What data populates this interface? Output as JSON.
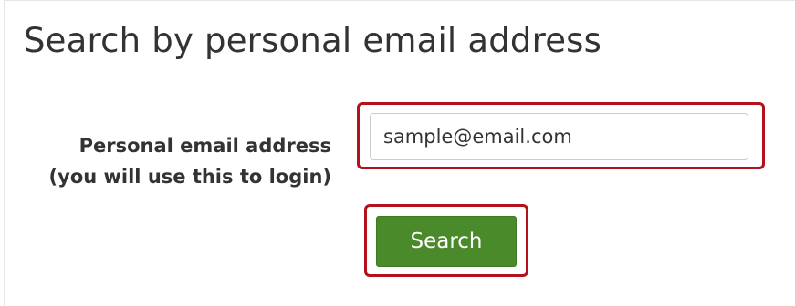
{
  "form": {
    "title": "Search by personal email address",
    "email_label_line1": "Personal email address",
    "email_label_line2": "(you will use this to login)",
    "email_value": "sample@email.com",
    "search_button_label": "Search"
  },
  "colors": {
    "highlight": "#b3121d",
    "button_bg": "#4a8a2b"
  }
}
